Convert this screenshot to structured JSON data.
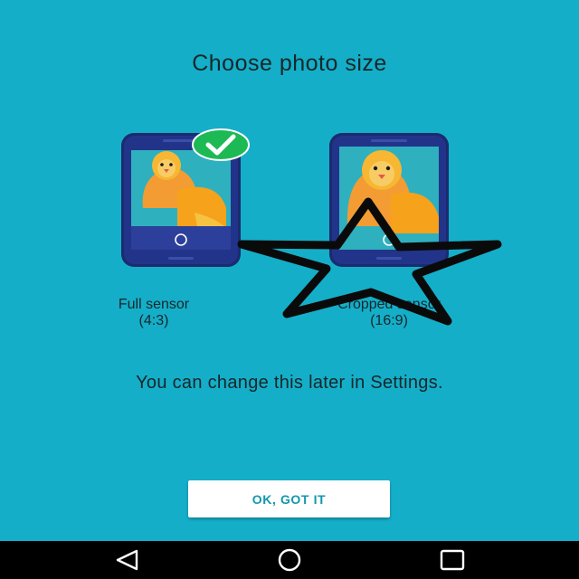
{
  "title": "Choose photo size",
  "options": [
    {
      "label": "Full sensor",
      "ratio": "(4:3)",
      "selected": true
    },
    {
      "label": "Cropped sensor",
      "ratio": "(16:9)",
      "selected": false
    }
  ],
  "hint": "You can change this later in Settings.",
  "ok_button": "OK, GOT IT",
  "icons": {
    "check": "checkmark-icon",
    "star": "star-outline-icon",
    "back": "back-triangle-icon",
    "home": "home-circle-icon",
    "recents": "recents-square-icon"
  },
  "colors": {
    "background": "#15aec8",
    "accent": "#1197ad",
    "check": "#1db954"
  }
}
